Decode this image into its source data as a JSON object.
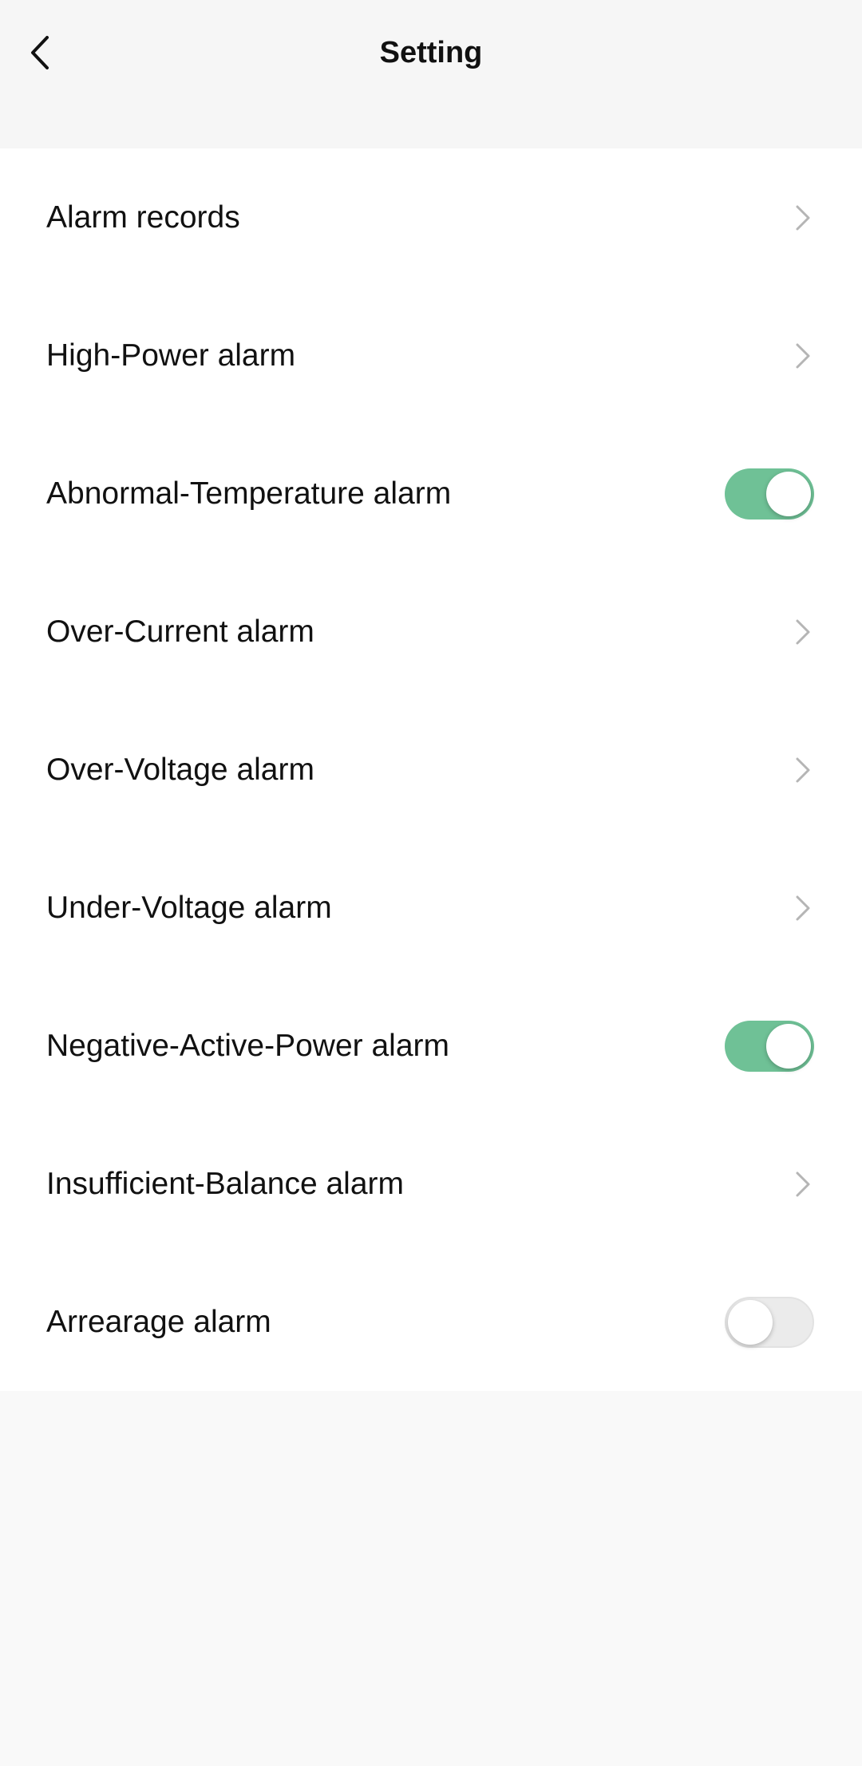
{
  "header": {
    "title": "Setting",
    "back_icon": "chevron-left-icon"
  },
  "colors": {
    "toggle_on": "#6fc196",
    "toggle_off": "#ebebeb",
    "chevron": "#b5b5b5"
  },
  "settings": {
    "items": [
      {
        "label": "Alarm records",
        "control": "chevron"
      },
      {
        "label": "High-Power alarm",
        "control": "chevron"
      },
      {
        "label": "Abnormal-Temperature alarm",
        "control": "toggle",
        "enabled": true
      },
      {
        "label": "Over-Current alarm",
        "control": "chevron"
      },
      {
        "label": "Over-Voltage alarm",
        "control": "chevron"
      },
      {
        "label": "Under-Voltage alarm",
        "control": "chevron"
      },
      {
        "label": "Negative-Active-Power alarm",
        "control": "toggle",
        "enabled": true
      },
      {
        "label": "Insufficient-Balance alarm",
        "control": "chevron"
      },
      {
        "label": "Arrearage alarm",
        "control": "toggle",
        "enabled": false
      }
    ]
  }
}
